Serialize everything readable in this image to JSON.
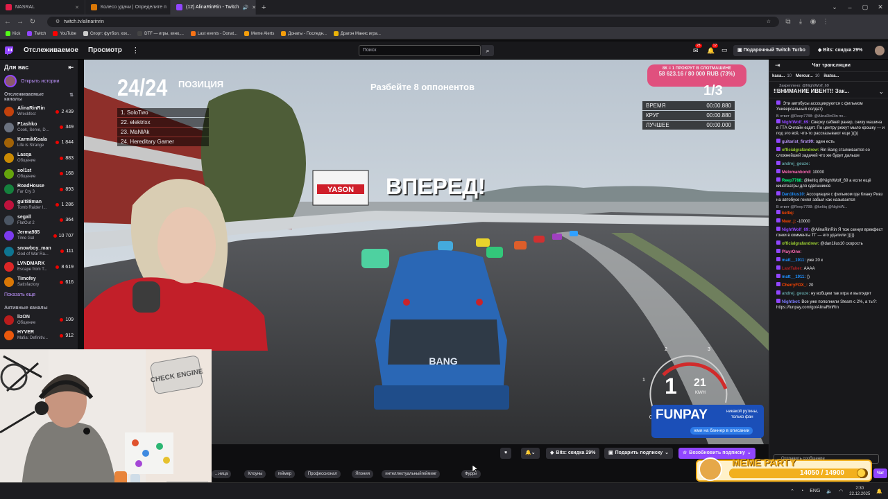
{
  "browser": {
    "tabs": [
      {
        "label": "NASRAL",
        "color": "#e11d48"
      },
      {
        "label": "Колесо удачи | Определите п",
        "color": "#d97706"
      },
      {
        "label": "(12) AlinaRinRin - Twitch",
        "color": "#9146ff"
      }
    ],
    "url": "twitch.tv/alinarinrin",
    "bookmarks": [
      {
        "label": "Kick",
        "color": "#53fc18"
      },
      {
        "label": "Twitch",
        "color": "#9146ff"
      },
      {
        "label": "YouTube",
        "color": "#ff0000"
      },
      {
        "label": "Спорт: футбол, хок...",
        "color": "#cccccc"
      },
      {
        "label": "DTF — игры, кино,...",
        "color": "#444444"
      },
      {
        "label": "Last events - Donat...",
        "color": "#f97316"
      },
      {
        "label": "Meme Alerts",
        "color": "#f59e0b"
      },
      {
        "label": "Донаты - Последн...",
        "color": "#f59e0b"
      },
      {
        "label": "Драгон Манис игра...",
        "color": "#eab308"
      }
    ]
  },
  "twitch_nav": {
    "following": "Отслеживаемое",
    "browse": "Просмотр",
    "search_placeholder": "Поиск",
    "notif_badge_1": "28",
    "notif_badge_2": "12",
    "turbo": "Подарочный Twitch Turbo",
    "bits": "Bits: скидка 29%"
  },
  "sidebar": {
    "title": "Для вас",
    "stories": "Открыть истории",
    "followed_heading": "Отслеживаемые каналы",
    "channels": [
      {
        "name": "AlinaRinRin",
        "game": "Wreckfest",
        "viewers": "2 439",
        "color": "#c2410c"
      },
      {
        "name": "F1ashko",
        "game": "Cook, Serve, D...",
        "viewers": "349",
        "color": "#6b7280"
      },
      {
        "name": "KarmikKoala",
        "game": "Life is Strange",
        "viewers": "1 844",
        "color": "#a16207"
      },
      {
        "name": "Lasqa",
        "game": "Общение",
        "viewers": "883",
        "color": "#ca8a04"
      },
      {
        "name": "sol1st",
        "game": "Общение",
        "viewers": "168",
        "color": "#65a30d"
      },
      {
        "name": "RoadHouse",
        "game": "Far Cry 3",
        "viewers": "893",
        "color": "#15803d"
      },
      {
        "name": "guit88man",
        "game": "Tomb Raider I...",
        "viewers": "1 286",
        "color": "#be123c"
      },
      {
        "name": "segall",
        "game": "FlatOut 2",
        "viewers": "364",
        "color": "#4b5563"
      },
      {
        "name": "Jerma985",
        "game": "Time Gal",
        "viewers": "10 707",
        "color": "#7c3aed"
      },
      {
        "name": "snowboy_man",
        "game": "God of War Ra...",
        "viewers": "111",
        "color": "#0e7490"
      },
      {
        "name": "LVNDMARK",
        "game": "Escape from T...",
        "viewers": "8 619",
        "color": "#dc2626"
      },
      {
        "name": "Timofey",
        "game": "Satisfactory",
        "viewers": "616",
        "color": "#d97706"
      }
    ],
    "show_more": "Показать еще",
    "active_heading": "Активные каналы",
    "active": [
      {
        "name": "lizON",
        "game": "Общение",
        "viewers": "109",
        "color": "#b91c1c"
      },
      {
        "name": "HYVER",
        "game": "Mafia: Definitiv...",
        "viewers": "912",
        "color": "#ea580c"
      }
    ]
  },
  "game": {
    "position_number": "24/24",
    "position_label": "ПОЗИЦИЯ",
    "standings": [
      "1. SoloTwo",
      "22. elektrixx",
      "23. MaNlAk",
      "24. Hereditary Gamer"
    ],
    "objective": "Разбейте 8 оппонентов",
    "go_text": "ВПЕРЕД!",
    "lap": "1/3",
    "timers": [
      {
        "label": "ВРЕМЯ",
        "value": "00:00.880"
      },
      {
        "label": "КРУГ",
        "value": "00:00.880"
      },
      {
        "label": "ЛУЧШЕЕ",
        "value": "00:00.000"
      }
    ],
    "slot_line1": "8К = 1 ПРОКРУТ В СЛОТМАШИНЕ",
    "slot_line2": "58 623.16 / 80 000 RUB (73%)",
    "slot_progress": 0.73,
    "gear": "1",
    "speed": "21",
    "speed_unit": "KM/H",
    "gauge_ticks": [
      "0",
      "1",
      "2",
      "3"
    ],
    "billboard": "YASON",
    "bus_graffiti": "BANG",
    "funpay_logo": "FUNPAY",
    "funpay_line1": "никакой рутины,",
    "funpay_line2": "только фан",
    "funpay_cta": "жми на баннер в описании"
  },
  "chat": {
    "title": "Чат трансляции",
    "top_chips": [
      {
        "name": "kasa...",
        "count": "10"
      },
      {
        "name": "Mercur...",
        "count": "10"
      },
      {
        "name": "ikatsa...",
        "count": ""
      }
    ],
    "pinned_label": "Закреплено: @NightWolf_69",
    "pinned_text": "‼ВНИМАНИЕ ИВЕНТ!! Зак...",
    "messages": [
      {
        "reply": "",
        "user": "",
        "color": "#ff4500",
        "text": "Эти автобусы ассоциируются с фильмом Универсальный солдат)"
      },
      {
        "reply": "В ответ @Reep7788: @AlinaRinRin по...",
        "user": "NightWolf_69:",
        "color": "#9147ff",
        "text": "Сверху сабвей ранер, снизу машина в ГТА Онлайн ездят. По центру режут мыло крошку — и под это всё, что-то рассказывают еще )))))"
      },
      {
        "reply": "",
        "user": "guitarist_first99:",
        "color": "#b794f4",
        "text": "один есть"
      },
      {
        "reply": "",
        "user": "officialgrafandrew:",
        "color": "#9acd32",
        "text": "Rin Bang сталкивается со сложнейшей задачей что же будет дальше"
      },
      {
        "reply": "",
        "user": "andrej_geuze:",
        "color": "#5f9ea0",
        "text": ""
      },
      {
        "reply": "",
        "user": "Melomanbond:",
        "color": "#ff69b4",
        "text": "10000"
      },
      {
        "reply": "",
        "user": "Reep7788:",
        "color": "#00ff7f",
        "text": "@keltiq @NightWolf_69 а если ещё кинотеатры для сдвгшников"
      },
      {
        "reply": "",
        "user": "Dan1lius10:",
        "color": "#1e90ff",
        "text": "Ассоциация с фильмом где Киану Ривз на автобусе гонял забыл как называется"
      },
      {
        "reply": "В ответ @Reep7788: @keltiq @NightW...",
        "user": "keltiq:",
        "color": "#ff4500",
        "text": ""
      },
      {
        "reply": "",
        "user": "Nvar_j:",
        "color": "#ff4500",
        "text": "-10000"
      },
      {
        "reply": "",
        "user": "NightWolf_69:",
        "color": "#9147ff",
        "text": "@AlinaRinRin Я тож скинул врекфест гонки в комменты ТГ — его удалили )))))"
      },
      {
        "reply": "",
        "user": "officialgrafandrew:",
        "color": "#9acd32",
        "text": "@dan1lius10 скорость"
      },
      {
        "reply": "",
        "user": "PlayrOne:",
        "color": "#ff69b4",
        "text": ""
      },
      {
        "reply": "",
        "user": "matt__1911:",
        "color": "#1e90ff",
        "text": "уже 20 к"
      },
      {
        "reply": "",
        "user": "LastTaker:",
        "color": "#b22222",
        "text": "АААА"
      },
      {
        "reply": "",
        "user": "matt__1911:",
        "color": "#1e90ff",
        "text": "))"
      },
      {
        "reply": "",
        "user": "CherryFOX_:",
        "color": "#ff4500",
        "text": "20"
      },
      {
        "reply": "",
        "user": "andrej_geuze:",
        "color": "#5f9ea0",
        "text": "ну вобщем так игра и выглядит"
      },
      {
        "reply": "",
        "user": "Nightbot:",
        "color": "#7c7cff",
        "text": "Все уже пополнили Steam с 2%, а ты?: https://funpay.com/go/AlinaRinRin"
      }
    ],
    "input_placeholder": "Отправить сообщение",
    "chat_button": "Чат"
  },
  "below_player": {
    "bits": "Bits: скидка 29%",
    "gift_sub": "Подарить подписку",
    "resub": "Возобновить подписку",
    "tags": [
      "...ница",
      "Клоуны",
      "геймер",
      "Профессионал",
      "Япония",
      "интеллектуальныйгейминг",
      "Фурри"
    ]
  },
  "meme_party": {
    "title": "MEME PARTY",
    "progress_text": "14050 / 14900",
    "progress": 0.943
  },
  "webcam_cover": {
    "sign_text": "CHECK ENGINE"
  },
  "taskbar": {
    "lang": "ENG",
    "time": "2:30",
    "date": "22.12.2025"
  },
  "colors": {
    "twitch_purple": "#9146ff",
    "live_red": "#eb0400",
    "slot_pink": "#e0507e"
  }
}
